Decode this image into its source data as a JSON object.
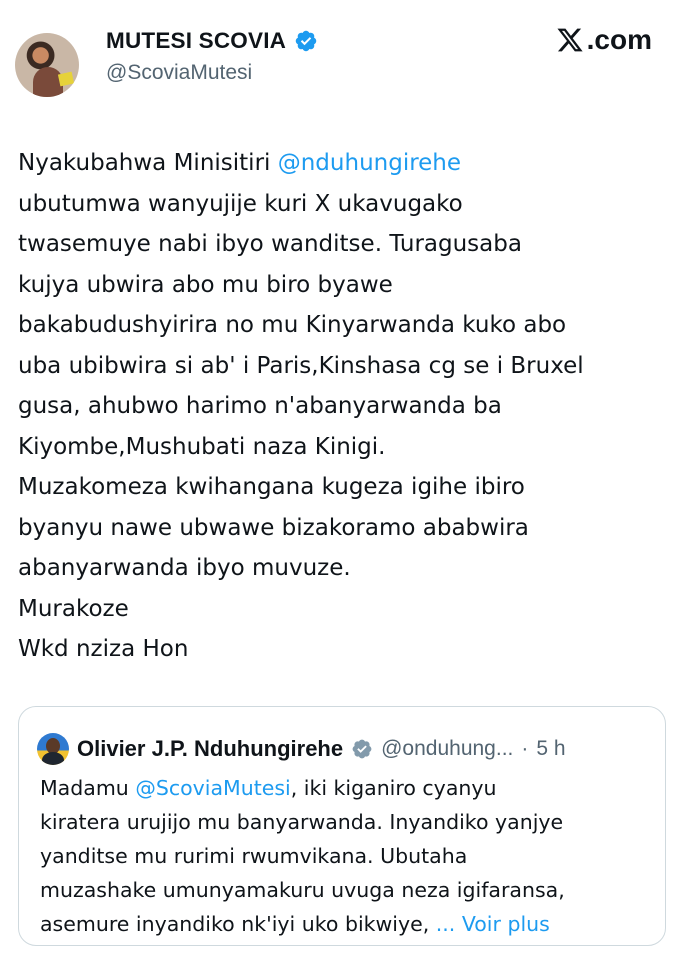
{
  "author": {
    "name": "MUTESI SCOVIA",
    "handle": "@ScoviaMutesi"
  },
  "site_label": ".com",
  "tweet": {
    "lines": [
      {
        "pre": "Nyakubahwa Minisitiri ",
        "mention": "@nduhungirehe",
        "post": ""
      },
      {
        "pre": "ubutumwa wanyujije kuri X ukavugako",
        "mention": "",
        "post": ""
      },
      {
        "pre": "twasemuye nabi ibyo wanditse. Turagusaba",
        "mention": "",
        "post": ""
      },
      {
        "pre": "kujya ubwira abo mu biro byawe",
        "mention": "",
        "post": ""
      },
      {
        "pre": "bakabudushyirira no mu Kinyarwanda kuko abo",
        "mention": "",
        "post": ""
      },
      {
        "pre": "uba ubibwira si ab' i Paris,Kinshasa cg se i Bruxel",
        "mention": "",
        "post": ""
      },
      {
        "pre": "gusa, ahubwo harimo n'abanyarwanda ba",
        "mention": "",
        "post": ""
      },
      {
        "pre": "Kiyombe,Mushubati naza Kinigi.",
        "mention": "",
        "post": ""
      },
      {
        "pre": "Muzakomeza kwihangana kugeza igihe ibiro",
        "mention": "",
        "post": ""
      },
      {
        "pre": "byanyu nawe ubwawe bizakoramo ababwira",
        "mention": "",
        "post": ""
      },
      {
        "pre": "abanyarwanda ibyo muvuze.",
        "mention": "",
        "post": ""
      },
      {
        "pre": "Murakoze",
        "mention": "",
        "post": ""
      },
      {
        "pre": "Wkd nziza Hon",
        "mention": "",
        "post": ""
      }
    ]
  },
  "quote": {
    "name": "Olivier J.P. Nduhungirehe",
    "handle": "@onduhung...",
    "separator": "·",
    "time": "5 h",
    "lines": [
      {
        "pre": "Madamu ",
        "mention": "@ScoviaMutesi",
        "post": ", iki kiganiro cyanyu",
        "more": ""
      },
      {
        "pre": "kiratera urujijo mu banyarwanda. Inyandiko yanjye",
        "mention": "",
        "post": "",
        "more": ""
      },
      {
        "pre": "yanditse mu rurimi rwumvikana. Ubutaha",
        "mention": "",
        "post": "",
        "more": ""
      },
      {
        "pre": "muzashake umunyamakuru uvuga neza igifaransa,",
        "mention": "",
        "post": "",
        "more": ""
      },
      {
        "pre": "asemure inyandiko nk'iyi uko bikwiye, ",
        "mention": "",
        "post": "",
        "more": "... Voir plus"
      }
    ]
  },
  "colors": {
    "text": "#0f1419",
    "secondary": "#536471",
    "link": "#1d9bf0",
    "border": "#cfd9de",
    "verified_badge": "#1d9bf0"
  },
  "icons": [
    "verified-badge-icon",
    "x-logo-icon"
  ]
}
